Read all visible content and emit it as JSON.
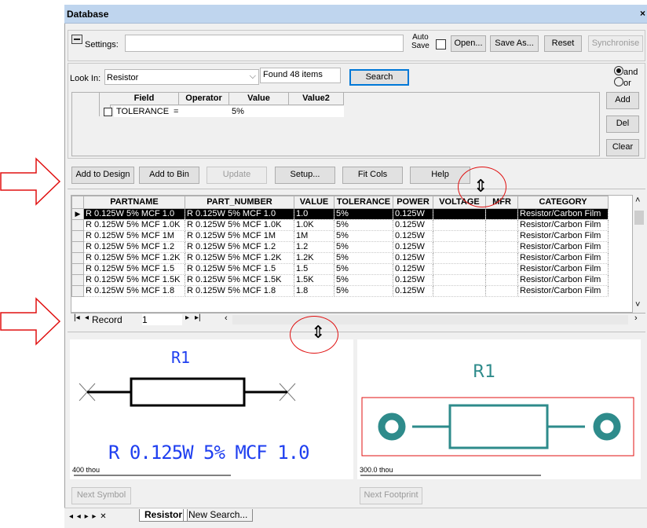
{
  "window": {
    "title": "Database",
    "close": "×"
  },
  "settings": {
    "label": "Settings:",
    "value": "",
    "auto_save": "Auto\nSave",
    "open": "Open...",
    "save_as": "Save As...",
    "reset": "Reset",
    "synchronise": "Synchronise"
  },
  "search": {
    "look_in_label": "Look In:",
    "look_in_value": "Resistor",
    "found": "Found 48 items",
    "search_button": "Search",
    "and": "and",
    "or": "or",
    "add": "Add",
    "del": "Del",
    "clear": "Clear",
    "query_headers": [
      "Field",
      "Operator",
      "Value",
      "Value2"
    ],
    "query_row": {
      "field": "TOLERANCE",
      "operator": "=",
      "value": "5%",
      "value2": ""
    }
  },
  "actions": {
    "add_to_design": "Add to Design",
    "add_to_bin": "Add to Bin",
    "update": "Update",
    "setup": "Setup...",
    "fit_cols": "Fit Cols",
    "help": "Help"
  },
  "results": {
    "columns": [
      "PARTNAME",
      "PART_NUMBER",
      "VALUE",
      "TOLERANCE",
      "POWER",
      "VOLTAGE",
      "MFR",
      "CATEGORY"
    ],
    "rows": [
      [
        "R 0.125W 5% MCF 1.0",
        "R 0.125W 5% MCF 1.0",
        "1.0",
        "5%",
        "0.125W",
        "",
        "",
        "Resistor/Carbon Film"
      ],
      [
        "R 0.125W 5% MCF 1.0K",
        "R 0.125W 5% MCF 1.0K",
        "1.0K",
        "5%",
        "0.125W",
        "",
        "",
        "Resistor/Carbon Film"
      ],
      [
        "R 0.125W 5% MCF 1M",
        "R 0.125W 5% MCF 1M",
        "1M",
        "5%",
        "0.125W",
        "",
        "",
        "Resistor/Carbon Film"
      ],
      [
        "R 0.125W 5% MCF 1.2",
        "R 0.125W 5% MCF 1.2",
        "1.2",
        "5%",
        "0.125W",
        "",
        "",
        "Resistor/Carbon Film"
      ],
      [
        "R 0.125W 5% MCF 1.2K",
        "R 0.125W 5% MCF 1.2K",
        "1.2K",
        "5%",
        "0.125W",
        "",
        "",
        "Resistor/Carbon Film"
      ],
      [
        "R 0.125W 5% MCF 1.5",
        "R 0.125W 5% MCF 1.5",
        "1.5",
        "5%",
        "0.125W",
        "",
        "",
        "Resistor/Carbon Film"
      ],
      [
        "R 0.125W 5% MCF 1.5K",
        "R 0.125W 5% MCF 1.5K",
        "1.5K",
        "5%",
        "0.125W",
        "",
        "",
        "Resistor/Carbon Film"
      ],
      [
        "R 0.125W 5% MCF 1.8",
        "R 0.125W 5% MCF 1.8",
        "1.8",
        "5%",
        "0.125W",
        "",
        "",
        "Resistor/Carbon Film"
      ]
    ],
    "record_label": "Record",
    "record_value": "1"
  },
  "preview": {
    "symbol_ref": "R1",
    "symbol_value": "R 0.125W 5% MCF 1.0",
    "symbol_scale": "400 thou",
    "next_symbol": "Next Symbol",
    "footprint_ref": "R1",
    "footprint_scale": "300.0 thou",
    "next_footprint": "Next Footprint"
  },
  "tabs": {
    "nav": "◂ ◂ ▸ ▸ ✕",
    "items": [
      "Resistor",
      "New Search..."
    ]
  },
  "colors": {
    "symbol_blue": "#1f3ff0",
    "footprint_teal": "#2e8b8b",
    "annotation_red": "#e01010",
    "selected_row": "#000000"
  }
}
